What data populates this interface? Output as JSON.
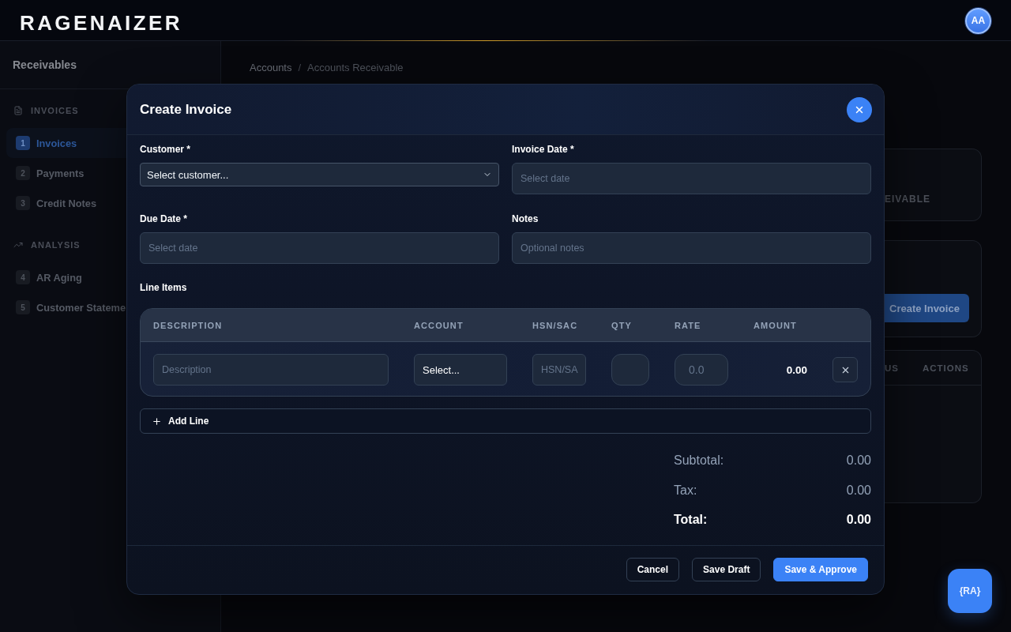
{
  "header": {
    "logo": "RAGENAIZER",
    "avatar": "AA"
  },
  "sidebar": {
    "title": "Receivables",
    "sections": [
      {
        "label": "INVOICES",
        "kind": "documents",
        "items": [
          {
            "number": "1",
            "label": "Invoices",
            "selected": true
          },
          {
            "number": "2",
            "label": "Payments",
            "selected": false
          },
          {
            "number": "3",
            "label": "Credit Notes",
            "selected": false
          }
        ]
      },
      {
        "label": "ANALYSIS",
        "kind": "trend",
        "items": [
          {
            "number": "4",
            "label": "AR Aging",
            "selected": false
          },
          {
            "number": "5",
            "label": "Customer Stateme",
            "selected": false
          }
        ]
      }
    ]
  },
  "breadcrumb": {
    "items": [
      "Accounts",
      "Accounts Receivable"
    ],
    "separator": "/"
  },
  "page_behind": {
    "summary_label": "EIVABLE",
    "create_button": "Create Invoice",
    "table_columns": [
      "US",
      "ACTIONS"
    ]
  },
  "modal": {
    "title": "Create Invoice",
    "fields": [
      {
        "label": "Customer *",
        "kind": "select",
        "value": "Select customer..."
      },
      {
        "label": "Invoice Date *",
        "kind": "input",
        "placeholder": "Select date"
      },
      {
        "label": "Due Date *",
        "kind": "input",
        "placeholder": "Select date"
      },
      {
        "label": "Notes",
        "kind": "input",
        "placeholder": "Optional notes"
      }
    ],
    "line_items": {
      "title": "Line Items",
      "columns": [
        "DESCRIPTION",
        "ACCOUNT",
        "HSN/SAC",
        "QTY",
        "RATE",
        "AMOUNT"
      ],
      "rows": [
        {
          "cells": [
            {
              "kind": "input",
              "placeholder": "Description"
            },
            {
              "kind": "select",
              "value": "Select..."
            },
            {
              "kind": "input",
              "placeholder": "HSN/SA"
            },
            {
              "kind": "number"
            },
            {
              "kind": "number",
              "placeholder": "0.0"
            },
            {
              "kind": "amount",
              "value": "0.00"
            }
          ]
        }
      ]
    },
    "add_line": "Add Line",
    "totals": [
      {
        "label": "Subtotal:",
        "value": "0.00",
        "kind": "line"
      },
      {
        "label": "Tax:",
        "value": "0.00",
        "kind": "line"
      },
      {
        "label": "Total:",
        "value": "0.00",
        "kind": "grand"
      }
    ],
    "buttons": [
      {
        "label": "Cancel",
        "kind": "secondary"
      },
      {
        "label": "Save Draft",
        "kind": "secondary"
      },
      {
        "label": "Save & Approve",
        "kind": "primary"
      }
    ]
  },
  "assistant_button": {
    "label": "{RA}"
  }
}
